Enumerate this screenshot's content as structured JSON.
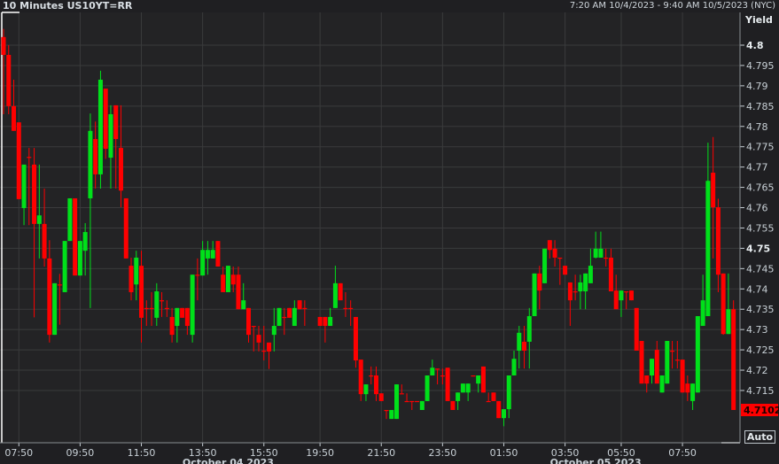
{
  "header": {
    "title": "10 Minutes US10YT=RR",
    "range": "7:20 AM 10/4/2023 - 9:40 AM 10/5/2023 (NYC)"
  },
  "axis_button": "Auto",
  "colors": {
    "up": "#00e01a",
    "down": "#ff0000",
    "grid": "#3a3b3c",
    "bg": "#232325"
  },
  "chart_data": {
    "type": "candlestick",
    "title": "10 Minutes US10YT=RR",
    "ylabel": "Yield",
    "ylim": [
      4.698,
      4.8068
    ],
    "yticks": [
      4.8,
      4.795,
      4.79,
      4.785,
      4.78,
      4.775,
      4.77,
      4.765,
      4.76,
      4.755,
      4.75,
      4.745,
      4.74,
      4.735,
      4.73,
      4.725,
      4.72,
      4.715
    ],
    "ytick_labels": [
      "4.8",
      "4.795",
      "4.79",
      "4.785",
      "4.78",
      "4.775",
      "4.77",
      "4.765",
      "4.76",
      "4.755",
      "4.75",
      "4.745",
      "4.74",
      "4.735",
      "4.73",
      "4.725",
      "4.72",
      "4.715"
    ],
    "bold_yticks": [
      "4.8",
      "4.75"
    ],
    "x_tick_labels": [
      {
        "label": "07:50",
        "bar": 3
      },
      {
        "label": "09:50",
        "bar": 15
      },
      {
        "label": "11:50",
        "bar": 27
      },
      {
        "label": "13:50",
        "bar": 39
      },
      {
        "label": "15:50",
        "bar": 51
      },
      {
        "label": "19:50",
        "bar": 62
      },
      {
        "label": "21:50",
        "bar": 74
      },
      {
        "label": "23:50",
        "bar": 86
      },
      {
        "label": "01:50",
        "bar": 98
      },
      {
        "label": "03:50",
        "bar": 110
      },
      {
        "label": "05:50",
        "bar": 121
      },
      {
        "label": "07:50",
        "bar": 133
      }
    ],
    "date_labels": [
      {
        "label": "October 04 2023",
        "bar": 44
      },
      {
        "label": "October 05 2023",
        "bar": 116
      }
    ],
    "last_price": "4.7102",
    "last_value": 4.7102,
    "candles_format": "[open, close, high, low] (high/low omitted = body extremes); null = no bar",
    "candles": [
      [
        4.802,
        4.7976,
        4.804,
        4.783
      ],
      [
        4.7976,
        4.785,
        4.8,
        4.783
      ],
      [
        4.785,
        4.7789,
        4.7915,
        4.7789
      ],
      [
        4.781,
        4.7621
      ],
      [
        4.7599,
        4.7706,
        4.7706,
        4.7557
      ],
      [
        4.7725,
        4.7725,
        4.7747,
        4.7557
      ],
      [
        4.7706,
        4.756,
        4.7747,
        4.733
      ],
      [
        4.756,
        4.7581,
        4.7706,
        4.7475
      ],
      [
        4.756,
        4.7475,
        4.7647,
        4.7455
      ],
      [
        4.7475,
        4.7287,
        4.752,
        4.7268
      ],
      [
        4.7287,
        4.7414
      ],
      [
        4.7411,
        4.7411,
        4.7437,
        4.7312
      ],
      [
        4.7392,
        4.7518
      ],
      [
        4.7518,
        4.7623
      ],
      [
        4.7623,
        4.7433
      ],
      [
        4.7433,
        4.7518
      ],
      [
        4.7494,
        4.754,
        4.7562,
        4.7433
      ],
      [
        4.7623,
        4.7789,
        4.7832,
        4.7353
      ],
      [
        4.7769,
        4.7682,
        4.7812,
        4.7647
      ],
      [
        4.7682,
        4.7915,
        4.7937,
        4.7647
      ],
      [
        4.7893,
        4.7745,
        4.7745,
        4.772
      ],
      [
        4.7723,
        4.783,
        4.7852,
        4.7647
      ],
      [
        4.7852,
        4.7769,
        4.7852,
        4.7647
      ],
      [
        4.7747,
        4.7642,
        4.7852,
        4.7601
      ],
      [
        4.7623,
        4.7475
      ],
      [
        4.7457,
        4.7392,
        4.7477,
        4.7372
      ],
      [
        4.7411,
        4.7477,
        4.7494,
        4.7372
      ],
      [
        4.7457,
        4.7329,
        4.7494,
        4.7268
      ],
      [
        4.7353,
        4.7353,
        4.7372,
        4.7309
      ],
      [
        4.7353,
        4.7353,
        4.7392,
        4.7309
      ],
      [
        4.7329,
        4.7394,
        4.7414,
        4.7309
      ],
      [
        4.7372,
        4.7372,
        4.7392,
        4.7331
      ],
      [
        4.7353,
        4.7353,
        4.7372,
        4.7331
      ],
      [
        4.7331,
        4.7287,
        4.7353,
        4.7268
      ],
      [
        4.7309,
        4.7353,
        4.7353,
        4.7268
      ],
      [
        4.7353,
        4.7329
      ],
      [
        4.7353,
        4.7309,
        4.7353,
        4.7287
      ],
      [
        4.7287,
        4.7435,
        4.7435,
        4.7268
      ],
      [
        4.7435,
        4.7435,
        4.7475,
        4.7372
      ],
      [
        4.7433,
        4.7496,
        4.7518,
        4.7433
      ],
      [
        4.7475,
        4.7496,
        4.7518,
        4.7435
      ],
      [
        4.7475,
        4.7496,
        4.7518,
        4.7475
      ],
      [
        4.7518,
        4.7455
      ],
      [
        4.7435,
        4.7392,
        4.7455,
        4.7392
      ],
      [
        4.7392,
        4.7457
      ],
      [
        4.7435,
        4.7411,
        4.7455,
        4.7392
      ],
      [
        4.7435,
        4.735,
        4.7455,
        4.735
      ],
      [
        4.735,
        4.7372,
        4.7414,
        4.735
      ],
      [
        4.7353,
        4.7287,
        4.7353,
        4.7268
      ],
      [
        4.7309,
        4.7309,
        4.7309,
        4.7246
      ],
      [
        4.7287,
        4.7268,
        4.7309,
        4.7246
      ],
      [
        4.7248,
        4.7248,
        4.7309,
        4.7224
      ],
      [
        4.7268,
        4.7246,
        4.7268,
        4.7203
      ],
      [
        4.7287,
        4.7309,
        4.7353,
        4.7246
      ],
      [
        4.7309,
        4.7353
      ],
      [
        4.7331,
        4.7331,
        4.7353,
        4.7287
      ],
      [
        4.7353,
        4.7329
      ],
      [
        4.7309,
        4.7353,
        4.7372,
        4.7309
      ],
      [
        4.7372,
        4.735
      ],
      [
        4.7353,
        4.7353,
        4.7372,
        4.7309
      ],
      null,
      null,
      [
        4.7331,
        4.7309
      ],
      [
        4.7331,
        4.7309,
        4.7331,
        4.7268
      ],
      [
        4.7309,
        4.7331,
        4.7353,
        4.7309
      ],
      [
        4.7353,
        4.7414,
        4.7457,
        4.7353
      ],
      [
        4.7414,
        4.7372
      ],
      [
        4.7353,
        4.7353,
        4.7392,
        4.7331
      ],
      [
        4.7353,
        4.7353,
        4.7372,
        4.7309
      ],
      [
        4.7331,
        4.7224,
        4.7331,
        4.7206
      ],
      [
        4.7226,
        4.7141,
        4.7226,
        4.7124
      ],
      [
        4.7141,
        4.7165,
        4.7165,
        4.7124
      ],
      [
        4.7187,
        4.7187,
        4.7209,
        4.7165
      ],
      [
        4.7187,
        4.7141,
        4.7209,
        4.7124
      ],
      [
        4.7143,
        4.7124
      ],
      [
        4.7102,
        4.7102,
        4.7102,
        4.708
      ],
      [
        4.708,
        4.7102,
        4.7102,
        4.708
      ],
      [
        4.708,
        4.7165
      ],
      [
        4.7143,
        4.7143,
        4.7165,
        4.7143
      ],
      [
        4.7124,
        4.7124,
        4.7143,
        4.7124
      ],
      [
        4.7124,
        4.7124,
        4.7124,
        4.7102
      ],
      [
        4.7124,
        4.7124
      ],
      [
        4.7102,
        4.7124
      ],
      [
        4.7124,
        4.7187
      ],
      [
        4.7187,
        4.7206,
        4.7226,
        4.7187
      ],
      [
        4.7204,
        4.7204,
        4.7204,
        4.7165
      ],
      [
        4.7187,
        4.7187,
        4.7204,
        4.7165
      ],
      [
        4.7206,
        4.7124
      ],
      [
        4.7124,
        4.7102
      ],
      [
        4.7124,
        4.7145,
        4.7145,
        4.7102
      ],
      [
        4.7145,
        4.7167
      ],
      [
        4.7145,
        4.7167,
        4.7167,
        4.7124
      ],
      [
        4.7187,
        4.7187
      ],
      [
        4.7167,
        4.7187,
        4.7187,
        4.7145
      ],
      [
        4.7209,
        4.7145
      ],
      [
        4.7124,
        4.7124,
        4.7145,
        4.7124
      ],
      [
        4.7145,
        4.7124
      ],
      [
        4.7124,
        4.7082
      ],
      [
        4.7082,
        4.7104,
        4.7104,
        4.7062
      ],
      [
        4.7104,
        4.7187,
        4.7187,
        4.7082
      ],
      [
        4.7187,
        4.7228,
        4.7248,
        4.7187
      ],
      [
        4.7248,
        4.7292,
        4.7309,
        4.7204
      ],
      [
        4.727,
        4.7248,
        4.7309,
        4.7204
      ],
      [
        4.727,
        4.7333,
        4.7353,
        4.7204
      ],
      [
        4.7333,
        4.7438
      ],
      [
        4.7438,
        4.7396,
        4.7457,
        4.735
      ],
      [
        4.7414,
        4.7499
      ],
      [
        4.752,
        4.7496,
        4.752,
        4.7475
      ],
      [
        4.7499,
        4.7477,
        4.752,
        4.7455
      ],
      [
        4.7477,
        4.7477,
        4.7477,
        4.741
      ],
      [
        4.7457,
        4.7435,
        4.7457,
        4.7435
      ],
      [
        4.7416,
        4.7372,
        4.7416,
        4.7309
      ],
      [
        4.7394,
        4.7394,
        4.7435,
        4.7372
      ],
      [
        4.7394,
        4.7416,
        4.7435,
        4.735
      ],
      [
        4.7394,
        4.7438,
        4.7438,
        4.735
      ],
      [
        4.7414,
        4.7457,
        4.7499,
        4.7414
      ],
      [
        4.7477,
        4.7499,
        4.7541,
        4.7475
      ],
      [
        4.7477,
        4.7499,
        4.7541,
        4.7477
      ],
      [
        4.7477,
        4.7477,
        4.7499,
        4.7455
      ],
      [
        4.7477,
        4.7394,
        4.7499,
        4.7394
      ],
      [
        4.7396,
        4.735,
        4.7435,
        4.735
      ],
      [
        4.7372,
        4.7396,
        4.7396,
        4.7331
      ],
      [
        4.7394,
        4.7394,
        4.7394,
        4.735
      ],
      [
        4.7396,
        4.7372
      ],
      [
        4.7353,
        4.7248
      ],
      [
        4.7272,
        4.7167
      ],
      [
        4.7187,
        4.7167,
        4.7187,
        4.7145
      ],
      [
        4.7187,
        4.7228,
        4.7228,
        4.7167
      ],
      [
        4.725,
        4.7167,
        4.7272,
        4.7167
      ],
      [
        4.7145,
        4.7187
      ],
      [
        4.7167,
        4.7272
      ],
      [
        4.7248,
        4.7248,
        4.7272,
        4.7204
      ],
      [
        4.7226,
        4.7226,
        4.7272,
        4.7204
      ],
      [
        4.7226,
        4.7145
      ],
      [
        4.7167,
        4.7145,
        4.7187,
        4.7124
      ],
      [
        4.7124,
        4.7167,
        4.7167,
        4.7102
      ],
      [
        4.7145,
        4.7333
      ],
      [
        4.7309,
        4.7372,
        4.7435,
        4.7309
      ],
      [
        4.7333,
        4.7666,
        4.776,
        4.7333
      ],
      [
        4.7686,
        4.7601,
        4.7774,
        4.7475
      ],
      [
        4.7601,
        4.7435,
        4.7622,
        4.7392
      ],
      [
        4.7438,
        4.7289,
        4.7438,
        4.7287
      ],
      [
        4.7289,
        4.735,
        4.7438,
        4.7289
      ],
      [
        4.735,
        4.7102,
        4.7372,
        4.7102
      ]
    ]
  }
}
